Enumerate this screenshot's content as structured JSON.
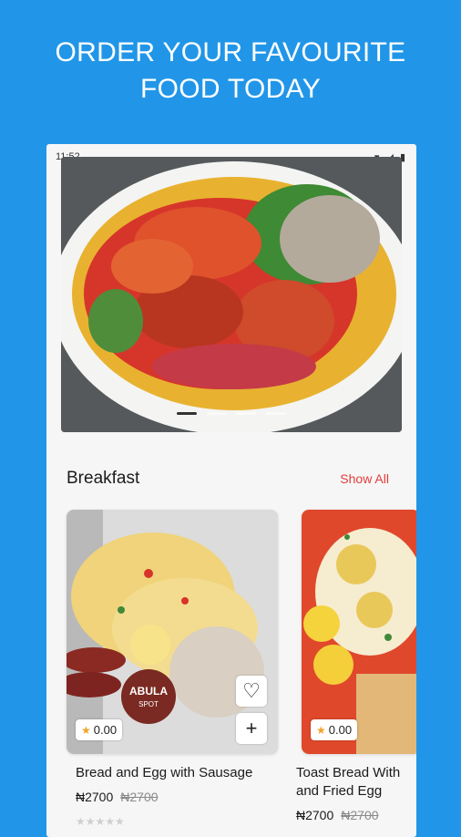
{
  "headline": {
    "line1": "ORDER YOUR FAVOURITE",
    "line2": "FOOD TODAY"
  },
  "status_bar": {
    "time": "11:52",
    "icons": [
      "shield-icon",
      "sim-icon",
      "wifi-icon",
      "signal-icon",
      "battery-icon"
    ]
  },
  "banner": {
    "image": "amala-ewedu-stew-plate",
    "dots_total": 4,
    "active_dot": 1
  },
  "section": {
    "title": "Breakfast",
    "show_all": "Show All"
  },
  "cards": [
    {
      "name": "Bread and Egg with Sausage",
      "rating": "0.00",
      "price": "₦2700",
      "old_price": "₦2700",
      "logo_text": "ABULA SPOT"
    },
    {
      "name": "Toast Bread With and Fried Egg",
      "rating": "0.00",
      "price": "₦2700",
      "old_price": "₦2700"
    }
  ],
  "colors": {
    "background": "#2196e8",
    "accent": "#e33b3b",
    "star": "#f2a32b"
  }
}
